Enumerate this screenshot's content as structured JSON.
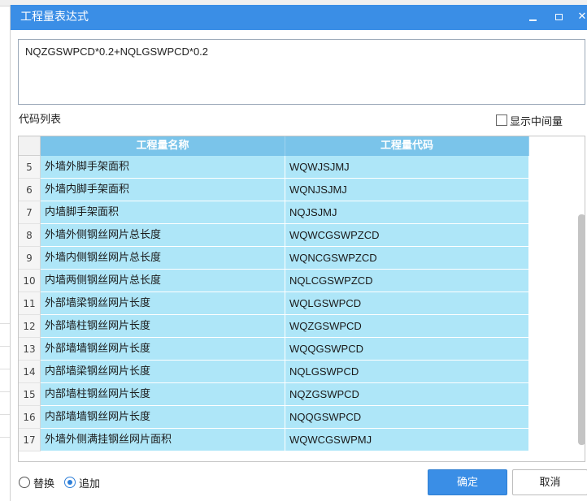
{
  "window": {
    "title": "工程量表达式",
    "minimize_icon": "minimize-icon",
    "maximize_icon": "maximize-icon",
    "close_icon": "close-icon",
    "close_glyph": "✕"
  },
  "expression": {
    "value": "NQZGSWPCD*0.2+NQLGSWPCD*0.2"
  },
  "code_list": {
    "label": "代码列表",
    "show_intermediate_label": "显示中间量",
    "show_intermediate_checked": false
  },
  "table": {
    "headers": {
      "name": "工程量名称",
      "code": "工程量代码"
    },
    "rows": [
      {
        "num": "5",
        "name": "外墙外脚手架面积",
        "code": "WQWJSJMJ"
      },
      {
        "num": "6",
        "name": "外墙内脚手架面积",
        "code": "WQNJSJMJ"
      },
      {
        "num": "7",
        "name": "内墙脚手架面积",
        "code": "NQJSJMJ"
      },
      {
        "num": "8",
        "name": "外墙外侧钢丝网片总长度",
        "code": "WQWCGSWPZCD"
      },
      {
        "num": "9",
        "name": "外墙内侧钢丝网片总长度",
        "code": "WQNCGSWPZCD"
      },
      {
        "num": "10",
        "name": "内墙两侧钢丝网片总长度",
        "code": "NQLCGSWPZCD"
      },
      {
        "num": "11",
        "name": "外部墙梁钢丝网片长度",
        "code": "WQLGSWPCD"
      },
      {
        "num": "12",
        "name": "外部墙柱钢丝网片长度",
        "code": "WQZGSWPCD"
      },
      {
        "num": "13",
        "name": "外部墙墙钢丝网片长度",
        "code": "WQQGSWPCD"
      },
      {
        "num": "14",
        "name": "内部墙梁钢丝网片长度",
        "code": "NQLGSWPCD"
      },
      {
        "num": "15",
        "name": "内部墙柱钢丝网片长度",
        "code": "NQZGSWPCD"
      },
      {
        "num": "16",
        "name": "内部墙墙钢丝网片长度",
        "code": "NQQGSWPCD"
      },
      {
        "num": "17",
        "name": "外墙外侧满挂钢丝网片面积",
        "code": "WQWCGSWPMJ"
      }
    ]
  },
  "footer": {
    "replace_label": "替换",
    "append_label": "追加",
    "selected_mode": "append",
    "ok_label": "确定",
    "cancel_label": "取消"
  },
  "colors": {
    "titlebar": "#3a8ee6",
    "header": "#7ac4ea",
    "row_bg": "#aee6f8",
    "ok_button": "#3a8ee6"
  }
}
